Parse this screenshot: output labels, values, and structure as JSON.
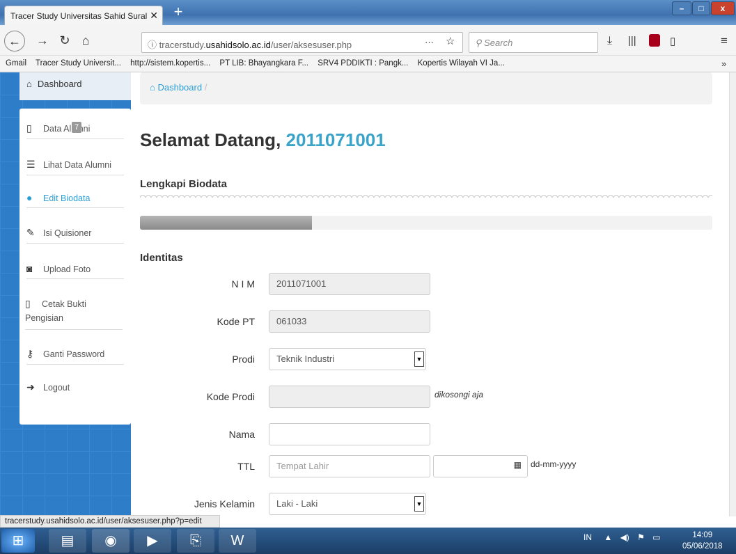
{
  "browser": {
    "tab_title": "Tracer Study Universitas Sahid Sural",
    "tab_close": "✕",
    "new_tab": "+",
    "url_prefix": "tracerstudy.",
    "url_domain": "usahidsolo.ac.id",
    "url_path": "/user/aksesuser.php",
    "url_more": "···",
    "search_placeholder": "Search",
    "bookmarks": [
      "Gmail",
      "Tracer Study Universit...",
      "http://sistem.kopertis...",
      "PT LIB: Bhayangkara F...",
      "SRV4 PDDIKTI : Pangk...",
      "Kopertis Wilayah VI Ja..."
    ],
    "bookmarks_overflow": "»",
    "status_url": "tracerstudy.usahidsolo.ac.id/user/aksesuser.php?p=edit"
  },
  "sidebar": {
    "dashboard": "Dashboard",
    "items": [
      {
        "label": "Data Alumni",
        "icon": "file-icon"
      },
      {
        "label": "Lihat Data Alumni",
        "icon": "list-icon"
      },
      {
        "label": "Edit Biodata",
        "icon": "user-icon"
      },
      {
        "label": "Isi Quisioner",
        "icon": "edit-icon"
      },
      {
        "label": "Upload Foto",
        "icon": "camera-icon"
      },
      {
        "label": "Cetak Bukti Pengisian",
        "icon": "file-icon"
      },
      {
        "label": "Ganti Password",
        "icon": "key-icon"
      },
      {
        "label": "Logout",
        "icon": "arrow-right-icon"
      }
    ],
    "badge": "7"
  },
  "breadcrumb": {
    "home": "Dashboard",
    "separator": "/"
  },
  "main": {
    "welcome": "Selamat Datang,",
    "user_id": "2011071001",
    "section_title": "Lengkapi Biodata",
    "progress_fraction": 0.3,
    "identitas_title": "Identitas",
    "form": {
      "nim_label": "N I M",
      "nim_value": "2011071001",
      "kodept_label": "Kode PT",
      "kodept_value": "061033",
      "prodi_label": "Prodi",
      "prodi_value": "Teknik Industri",
      "kodeprodi_label": "Kode Prodi",
      "kodeprodi_hint": "dikosongi aja",
      "nama_label": "Nama",
      "ttl_label": "TTL",
      "ttl_place_placeholder": "Tempat Lahir",
      "ttl_date_format": "dd-mm-yyyy",
      "jk_label": "Jenis Kelamin",
      "jk_value": "Laki - Laki"
    }
  },
  "taskbar": {
    "lang": "IN",
    "time": "14:09",
    "date": "05/06/2018"
  },
  "colors": {
    "accent": "#3aa3c9",
    "link": "#2a9fd6",
    "sidebar_bg": "#2d7dc8"
  }
}
